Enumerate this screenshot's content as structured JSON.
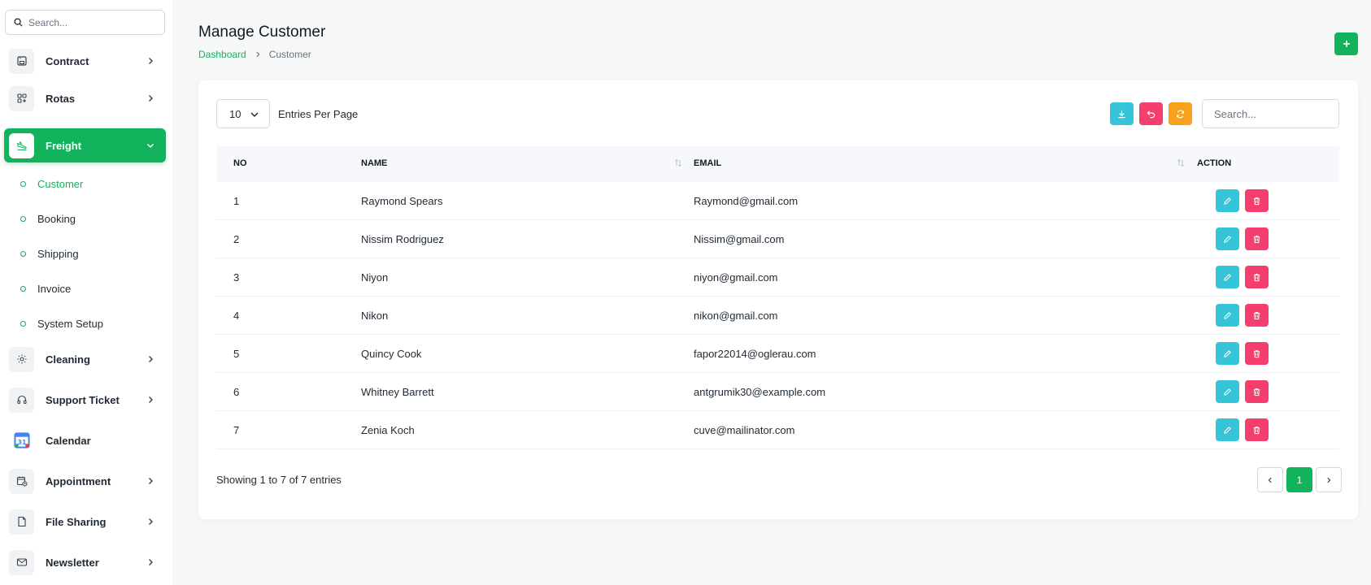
{
  "sidebar": {
    "search_placeholder": "Search...",
    "items": [
      {
        "label": "Contract",
        "icon": "save-icon"
      },
      {
        "label": "Rotas",
        "icon": "grid-add-icon"
      },
      {
        "label": "Freight",
        "icon": "plane-landing-icon"
      },
      {
        "label": "Cleaning",
        "icon": "sun-icon"
      },
      {
        "label": "Support Ticket",
        "icon": "headset-icon"
      },
      {
        "label": "Calendar",
        "icon": "calendar-app-icon"
      },
      {
        "label": "Appointment",
        "icon": "calendar-clock-icon"
      },
      {
        "label": "File Sharing",
        "icon": "file-icon"
      },
      {
        "label": "Newsletter",
        "icon": "mail-icon"
      }
    ],
    "freight_sub": [
      "Customer",
      "Booking",
      "Shipping",
      "Invoice",
      "System Setup"
    ],
    "calendar_badge": "31"
  },
  "header": {
    "title": "Manage Customer",
    "breadcrumb": {
      "home": "Dashboard",
      "current": "Customer"
    }
  },
  "toolbar": {
    "entries_value": "10",
    "entries_label": "Entries Per Page",
    "search_placeholder": "Search..."
  },
  "table": {
    "headers": {
      "no": "NO",
      "name": "NAME",
      "email": "EMAIL",
      "action": "ACTION"
    },
    "rows": [
      {
        "no": "1",
        "name": "Raymond Spears",
        "email": "Raymond@gmail.com"
      },
      {
        "no": "2",
        "name": "Nissim Rodriguez",
        "email": "Nissim@gmail.com"
      },
      {
        "no": "3",
        "name": "Niyon",
        "email": "niyon@gmail.com"
      },
      {
        "no": "4",
        "name": "Nikon",
        "email": "nikon@gmail.com"
      },
      {
        "no": "5",
        "name": "Quincy Cook",
        "email": "fapor22014@oglerau.com"
      },
      {
        "no": "6",
        "name": "Whitney Barrett",
        "email": "antgrumik30@example.com"
      },
      {
        "no": "7",
        "name": "Zenia Koch",
        "email": "cuve@mailinator.com"
      }
    ]
  },
  "footer": {
    "showing": "Showing 1 to 7 of 7 entries",
    "current_page": "1"
  },
  "colors": {
    "primary": "#12b35c",
    "info": "#36c5d8",
    "danger": "#f43f6e",
    "warning": "#f7a21c"
  }
}
